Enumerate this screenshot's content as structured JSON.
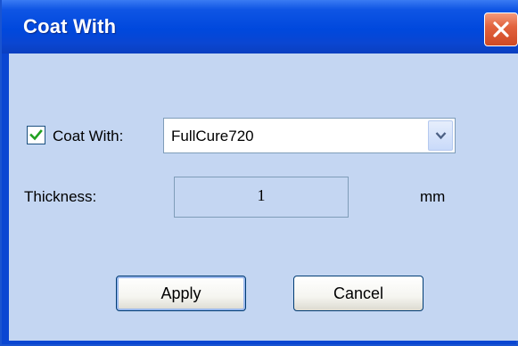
{
  "window": {
    "title": "Coat With",
    "close_icon": "close-icon"
  },
  "form": {
    "coat_with": {
      "checked": true,
      "label": "Coat With:",
      "selected": "FullCure720",
      "dropdown_icon": "chevron-down-icon"
    },
    "thickness": {
      "label": "Thickness:",
      "value": "1",
      "unit": "mm"
    }
  },
  "buttons": {
    "apply_label": "Apply",
    "cancel_label": "Cancel"
  },
  "colors": {
    "titlebar": "#0a46d2",
    "client_bg": "#c4d6f2",
    "close_button": "#d9552f",
    "checkmark": "#21a121"
  }
}
